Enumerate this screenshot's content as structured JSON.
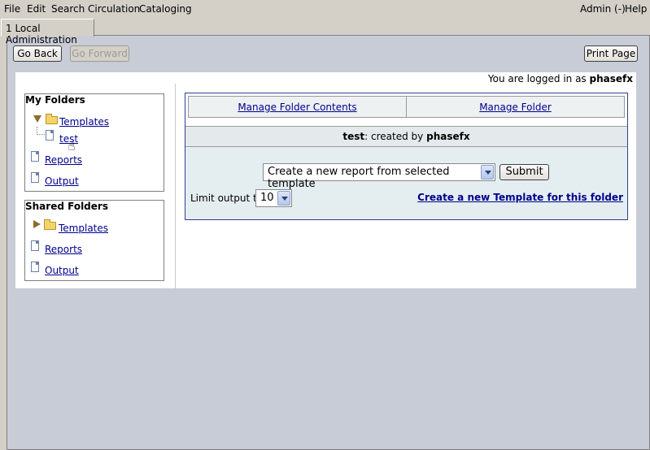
{
  "menu": {
    "file": "File",
    "edit": "Edit",
    "search": "Search",
    "circulation": "Circulation",
    "cataloging": "Cataloging",
    "admin": "Admin (-)",
    "help": "Help"
  },
  "tab": {
    "label": "1 Local Administration"
  },
  "toolbar": {
    "go_back": "Go Back",
    "go_forward": "Go Forward",
    "print_page": "Print Page"
  },
  "login": {
    "prefix": "You are logged in as",
    "user": "phasefx"
  },
  "my_folders": {
    "title": "My Folders",
    "templates": "Templates",
    "test": "test",
    "reports": "Reports",
    "output": "Output"
  },
  "shared_folders": {
    "title": "Shared Folders",
    "templates": "Templates",
    "reports": "Reports",
    "output": "Output"
  },
  "panel": {
    "tab_contents": "Manage Folder Contents",
    "tab_folder": "Manage Folder",
    "folder_name": "test",
    "created_by_text": ": created by",
    "creator": "phasefx",
    "action_select": "Create a new report from selected template",
    "submit": "Submit",
    "limit_label": "Limit output to",
    "limit_value": "10",
    "new_template_link": "Create a new Template for this folder"
  },
  "colors": {
    "link": "#00008b",
    "panel_border": "#2e3f8f",
    "pane_bg": "#c7ccd6"
  }
}
